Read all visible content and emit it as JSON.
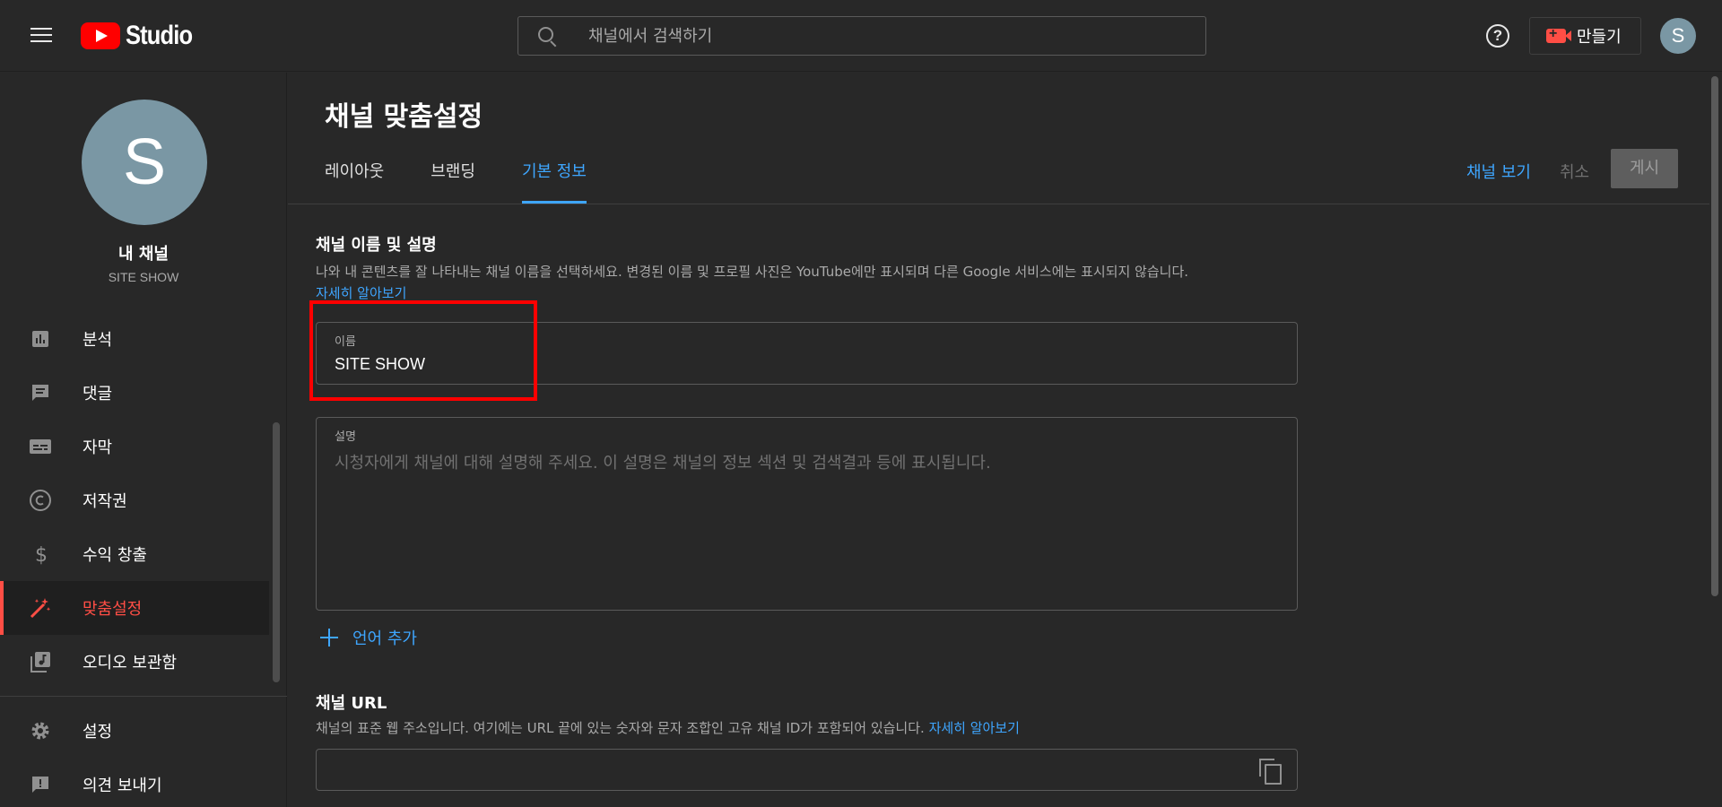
{
  "header": {
    "logo_text": "Studio",
    "search_placeholder": "채널에서 검색하기",
    "help_symbol": "?",
    "create_label": "만들기",
    "avatar_letter": "S"
  },
  "sidebar": {
    "avatar_letter": "S",
    "channel_title": "내 채널",
    "channel_handle": "SITE SHOW",
    "items": [
      {
        "label": "분석",
        "icon": "analytics-icon"
      },
      {
        "label": "댓글",
        "icon": "comments-icon"
      },
      {
        "label": "자막",
        "icon": "subtitles-icon"
      },
      {
        "label": "저작권",
        "icon": "copyright-icon"
      },
      {
        "label": "수익 창출",
        "icon": "monetization-icon"
      },
      {
        "label": "맞춤설정",
        "icon": "customization-icon",
        "active": true
      },
      {
        "label": "오디오 보관함",
        "icon": "audio-library-icon"
      }
    ],
    "bottom_items": [
      {
        "label": "설정",
        "icon": "settings-icon"
      },
      {
        "label": "의견 보내기",
        "icon": "feedback-icon"
      }
    ]
  },
  "main": {
    "page_title": "채널 맞춤설정",
    "tabs": [
      {
        "label": "레이아웃"
      },
      {
        "label": "브랜딩"
      },
      {
        "label": "기본 정보",
        "active": true
      }
    ],
    "actions": {
      "view_channel": "채널 보기",
      "cancel": "취소",
      "publish": "게시"
    },
    "name_section": {
      "title": "채널 이름 및 설명",
      "description": "나와 내 콘텐츠를 잘 나타내는 채널 이름을 선택하세요. 변경된 이름 및 프로필 사진은 YouTube에만 표시되며 다른 Google 서비스에는 표시되지 않습니다.",
      "learn_more": "자세히 알아보기",
      "name_label": "이름",
      "name_value": "SITE SHOW",
      "desc_label": "설명",
      "desc_placeholder": "시청자에게 채널에 대해 설명해 주세요. 이 설명은 채널의 정보 섹션 및 검색결과 등에 표시됩니다.",
      "add_language": "언어 추가"
    },
    "url_section": {
      "title": "채널 URL",
      "description": "채널의 표준 웹 주소입니다. 여기에는 URL 끝에 있는 숫자와 문자 조합인 고유 채널 ID가 포함되어 있습니다.",
      "learn_more": "자세히 알아보기",
      "url_value": ""
    }
  },
  "colors": {
    "accent": "#3ea6ff",
    "active_red": "#ff4e45",
    "highlight": "#ff0000",
    "background": "#282828"
  }
}
